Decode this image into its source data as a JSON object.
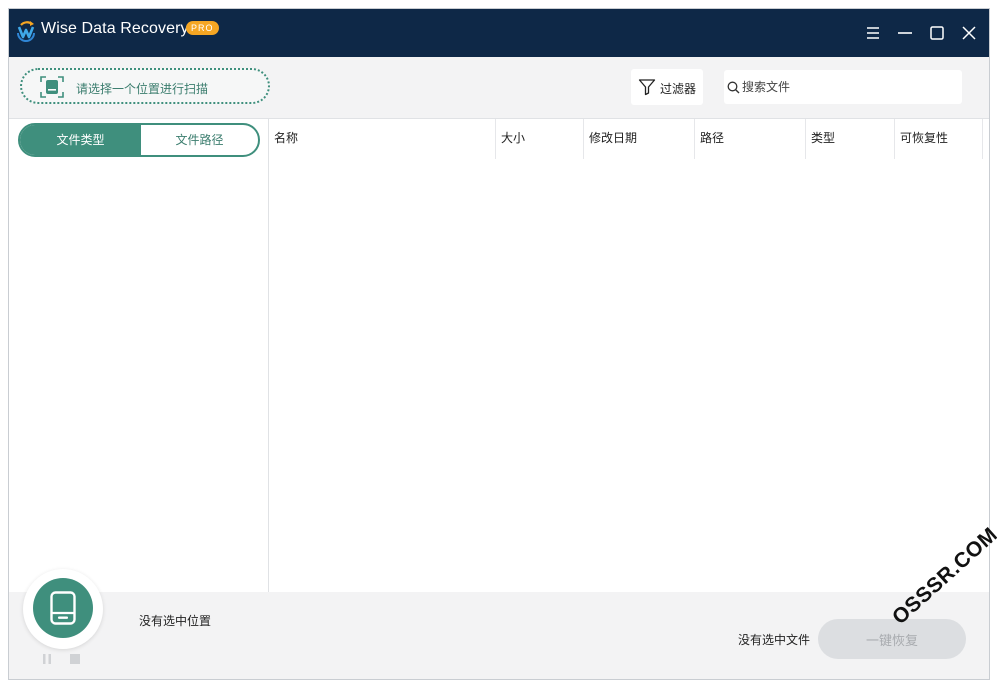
{
  "window": {
    "title": "Wise Data Recovery",
    "badge": "PRO"
  },
  "toolbar": {
    "scan_location_label": "请选择一个位置进行扫描",
    "filter_label": "过滤器",
    "search_placeholder": "搜索文件"
  },
  "sidebar": {
    "tabs": [
      {
        "label": "文件类型",
        "active": true
      },
      {
        "label": "文件路径",
        "active": false
      }
    ]
  },
  "table": {
    "columns": [
      "名称",
      "大小",
      "修改日期",
      "路径",
      "类型",
      "可恢复性"
    ],
    "rows": []
  },
  "footer": {
    "location_status": "没有选中位置",
    "file_status": "没有选中文件",
    "recover_label": "一键恢复"
  },
  "watermark": "OSSSR.COM",
  "colors": {
    "titlebar": "#0e2847",
    "accent": "#3f8f7d",
    "badge": "#f5a623",
    "disabled_button": "#dcdee1"
  }
}
